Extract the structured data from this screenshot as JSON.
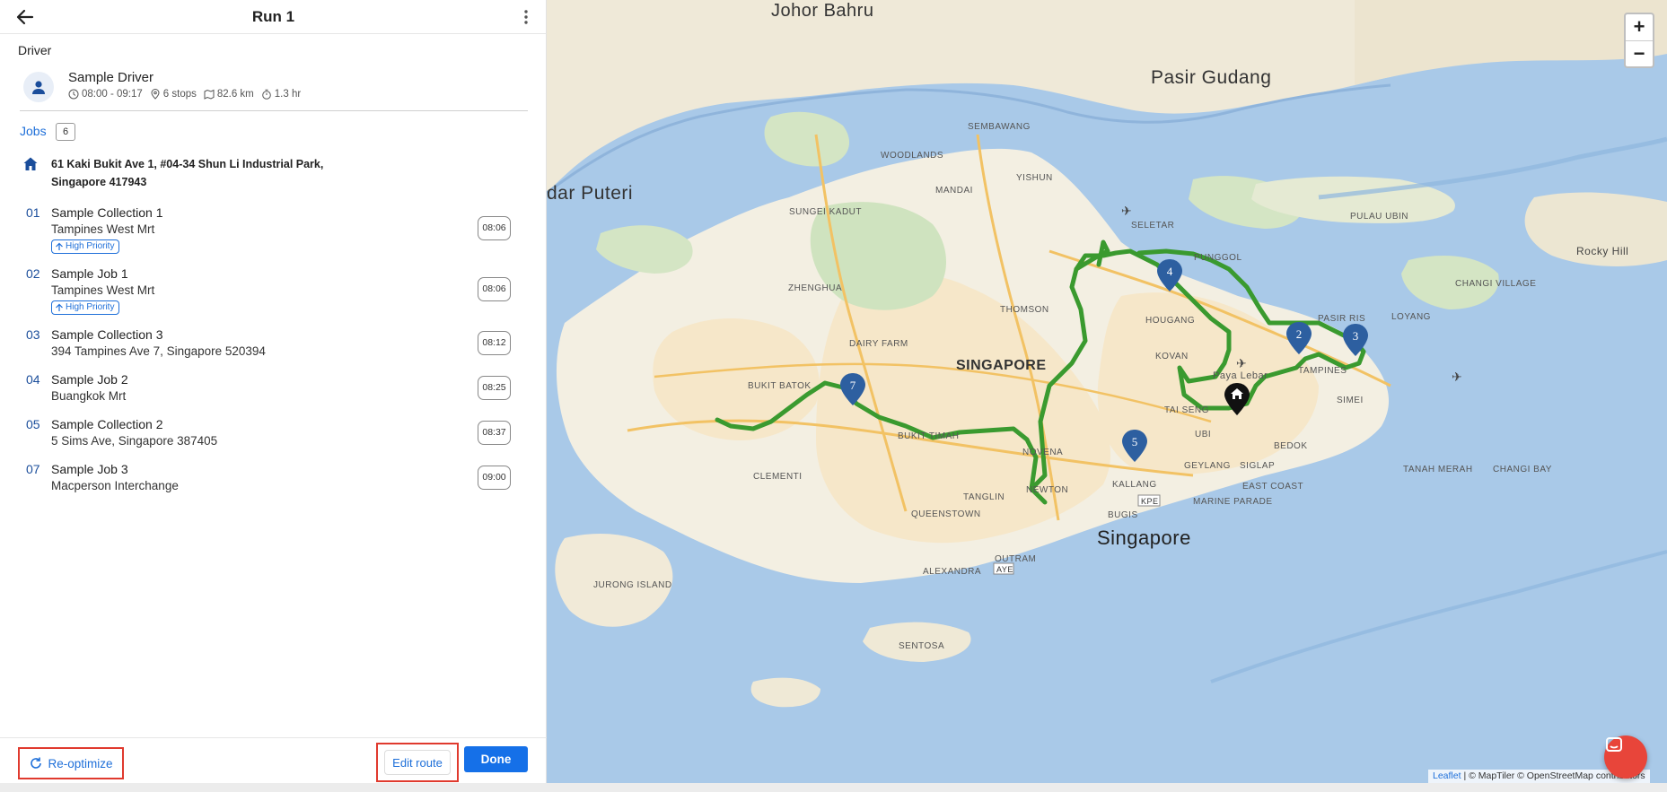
{
  "header": {
    "title": "Run 1",
    "back_icon": "arrow-left-icon",
    "more_icon": "more-vertical-icon"
  },
  "driver": {
    "section_label": "Driver",
    "name": "Sample Driver",
    "time_range": "08:00 - 09:17",
    "stops": "6 stops",
    "distance": "82.6 km",
    "duration": "1.3 hr"
  },
  "jobs_tab": {
    "label": "Jobs",
    "count": "6"
  },
  "depot": {
    "address_line1": "61 Kaki Bukit Ave 1, #04-34 Shun Li Industrial Park,",
    "address_line2": "Singapore 417943"
  },
  "jobs": [
    {
      "num": "01",
      "title": "Sample Collection 1",
      "sub": "Tampines West Mrt",
      "priority": "High Priority",
      "time": "08:06"
    },
    {
      "num": "02",
      "title": "Sample Job 1",
      "sub": "Tampines West Mrt",
      "priority": "High Priority",
      "time": "08:06"
    },
    {
      "num": "03",
      "title": "Sample Collection 3",
      "sub": "394 Tampines Ave 7, Singapore 520394",
      "priority": "",
      "time": "08:12"
    },
    {
      "num": "04",
      "title": "Sample Job 2",
      "sub": "Buangkok Mrt",
      "priority": "",
      "time": "08:25"
    },
    {
      "num": "05",
      "title": "Sample Collection 2",
      "sub": "5 Sims Ave, Singapore 387405",
      "priority": "",
      "time": "08:37"
    },
    {
      "num": "07",
      "title": "Sample Job 3",
      "sub": "Macperson Interchange",
      "priority": "",
      "time": "09:00"
    }
  ],
  "footer": {
    "reoptimize": "Re-optimize",
    "edit_route": "Edit route",
    "done": "Done"
  },
  "map": {
    "zoom_in": "+",
    "zoom_out": "−",
    "attribution_leaflet": "Leaflet",
    "attribution_rest": "| © MapTiler © OpenStreetMap contributors",
    "markers": [
      "2",
      "3",
      "4",
      "5",
      "7"
    ],
    "labels": {
      "johor_bahru": "Johor Bahru",
      "pasir_gudang": "Pasir Gudang",
      "singapore_big": "Singapore",
      "singapore_region": "SINGAPORE",
      "bandar_puteri": "dar Puteri",
      "woodlands": "WOODLANDS",
      "sembawang": "SEMBAWANG",
      "mandai": "MANDAI",
      "yishun": "YISHUN",
      "seletar": "SELETAR",
      "punggol": "PUNGGOL",
      "pasir_ris": "PASIR RIS",
      "tampines": "TAMPINES",
      "hougang": "HOUGANG",
      "kovan": "KOVAN",
      "bukit_batok": "BUKIT BATOK",
      "bukit_timah": "BUKIT TIMAH",
      "novena": "NOVENA",
      "geylang": "GEYLANG",
      "kallang": "KALLANG",
      "bedok": "BEDOK",
      "simei": "SIMEI",
      "clementi": "CLEMENTI",
      "queenstown": "QUEENSTOWN",
      "tanglin": "TANGLIN",
      "newton": "NEWTON",
      "bugis": "BUGIS",
      "outram": "OUTRAM",
      "alexandra": "ALEXANDRA",
      "pulau_ubin": "PULAU UBIN",
      "changi_village": "CHANGI VILLAGE",
      "tanah_merah": "TANAH MERAH",
      "changi_bay": "CHANGI BAY",
      "jurong_island": "JURONG ISLAND",
      "sentosa": "SENTOSA",
      "east_coast": "EAST COAST",
      "marine_parade": "MARINE PARADE",
      "siglap": "SIGLAP",
      "tai_seng": "TAI SENG",
      "ubi": "UBI",
      "dairy_farm": "DAIRY FARM",
      "zhenghua": "ZHENGHUA",
      "sungei_kadut": "SUNGEI KADUT",
      "thomson": "THOMSON",
      "rocky_hill": "Rocky Hill",
      "loyang": "LOYANG",
      "paya_lebar": "Paya Lebar",
      "kpe": "KPE",
      "aye": "AYE"
    }
  }
}
